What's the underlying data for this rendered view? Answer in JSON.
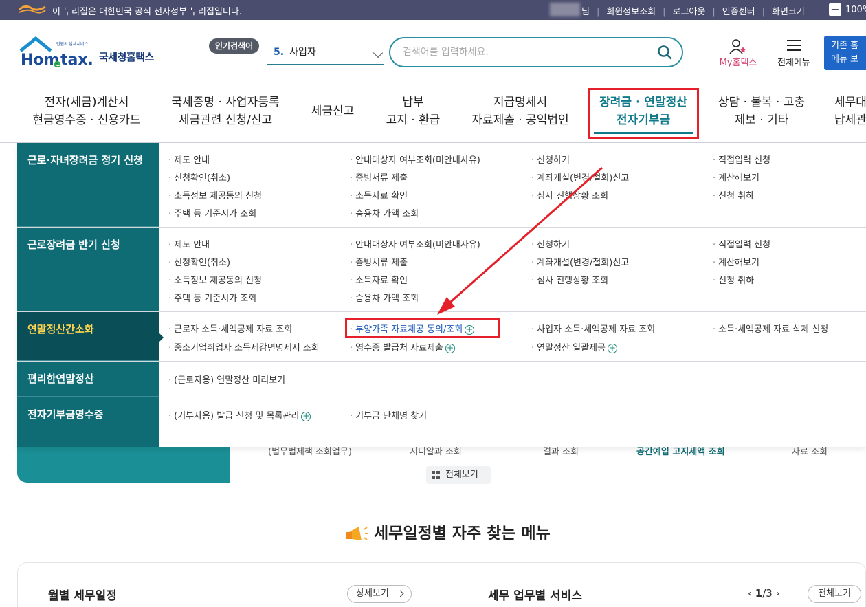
{
  "gov_bar": {
    "notice": "이 누리집은 대한민국 공식 전자정부 누리집입니다.",
    "user_suffix": "님",
    "links": [
      "회원정보조회",
      "로그아웃",
      "인증센터",
      "화면크기"
    ],
    "zoom": "100%"
  },
  "header": {
    "logo_small": "민원의 납세서비스",
    "logo_text": "Hometax.",
    "logo_ko": "국세청홈택스",
    "popular_label": "인기검색어",
    "popular_rank": "5.",
    "popular_term": "사업자",
    "search_placeholder": "검색어를 입력하세요.",
    "my_hometax": "My홈택스",
    "all_menu": "전체메뉴",
    "old_menu_l1": "기존 홈",
    "old_menu_l2": "메뉴 보"
  },
  "nav": [
    {
      "l1": "전자(세금)계산서",
      "l2": "현금영수증 · 신용카드"
    },
    {
      "l1": "국세증명 · 사업자등록",
      "l2": "세금관련 신청/신고"
    },
    {
      "l1": "세금신고",
      "l2": ""
    },
    {
      "l1": "납부",
      "l2": "고지 · 환급"
    },
    {
      "l1": "지급명세서",
      "l2": "자료제출 · 공익법인"
    },
    {
      "l1": "장려금 · 연말정산",
      "l2": "전자기부금"
    },
    {
      "l1": "상담 · 불복 · 고충",
      "l2": "제보 · 기타"
    },
    {
      "l1": "세무대",
      "l2": "납세관"
    }
  ],
  "mega": {
    "rows": [
      {
        "category": "근로·자녀장려금 정기 신청",
        "links": [
          "제도 안내",
          "안내대상자 여부조회(미안내사유)",
          "신청하기",
          "직접입력 신청",
          "신청확인(취소)",
          "증빙서류 제출",
          "계좌개설(변경/철회)신고",
          "계산해보기",
          "소득정보 제공동의 신청",
          "소득자료 확인",
          "심사 진행상황 조회",
          "신청 취하",
          "주택 등 기준시가 조회",
          "승용차 가액 조회"
        ]
      },
      {
        "category": "근로장려금 반기 신청",
        "links": [
          "제도 안내",
          "안내대상자 여부조회(미안내사유)",
          "신청하기",
          "직접입력 신청",
          "신청확인(취소)",
          "증빙서류 제출",
          "계좌개설(변경/철회)신고",
          "계산해보기",
          "소득정보 제공동의 신청",
          "소득자료 확인",
          "심사 진행상황 조회",
          "신청 취하",
          "주택 등 기준시가 조회",
          "승용차 가액 조회"
        ]
      },
      {
        "category": "연말정산간소화",
        "links": [
          "근로자 소득·세액공제 자료 조회",
          "부양가족 자료제공 동의/조회",
          "사업자 소득·세액공제 자료 조회",
          "소득·세액공제 자료 삭제 신청",
          "중소기업취업자 소득세감면명세서 조회",
          "영수증 발급처 자료제출",
          "연말정산 일괄제공"
        ]
      },
      {
        "category": "편리한연말정산",
        "links": [
          "(근로자용) 연말정산 미리보기"
        ]
      },
      {
        "category": "전자기부금영수증",
        "links": [
          "(기부자용) 발급 신청 및 목록관리",
          "기부금 단체명 찾기"
        ]
      }
    ]
  },
  "under": {
    "items": [
      "(법무법제책 조회업무)",
      "지디알과 조회",
      "결과 조회",
      "공간예입 고지세액 조회",
      "자료 조회"
    ],
    "view_all": "전체보기"
  },
  "section": {
    "title": "세무일정별 자주 찾는 메뉴",
    "monthly": "월별 세무일정",
    "detail": "상세보기",
    "service": "세무 업무별 서비스",
    "page_current": "1",
    "page_total": "/3",
    "all": "전체보기"
  },
  "colors": {
    "accent_teal": "#0f6b74",
    "highlight_red": "#e5202a",
    "gov_bar": "#4b4d6e"
  }
}
